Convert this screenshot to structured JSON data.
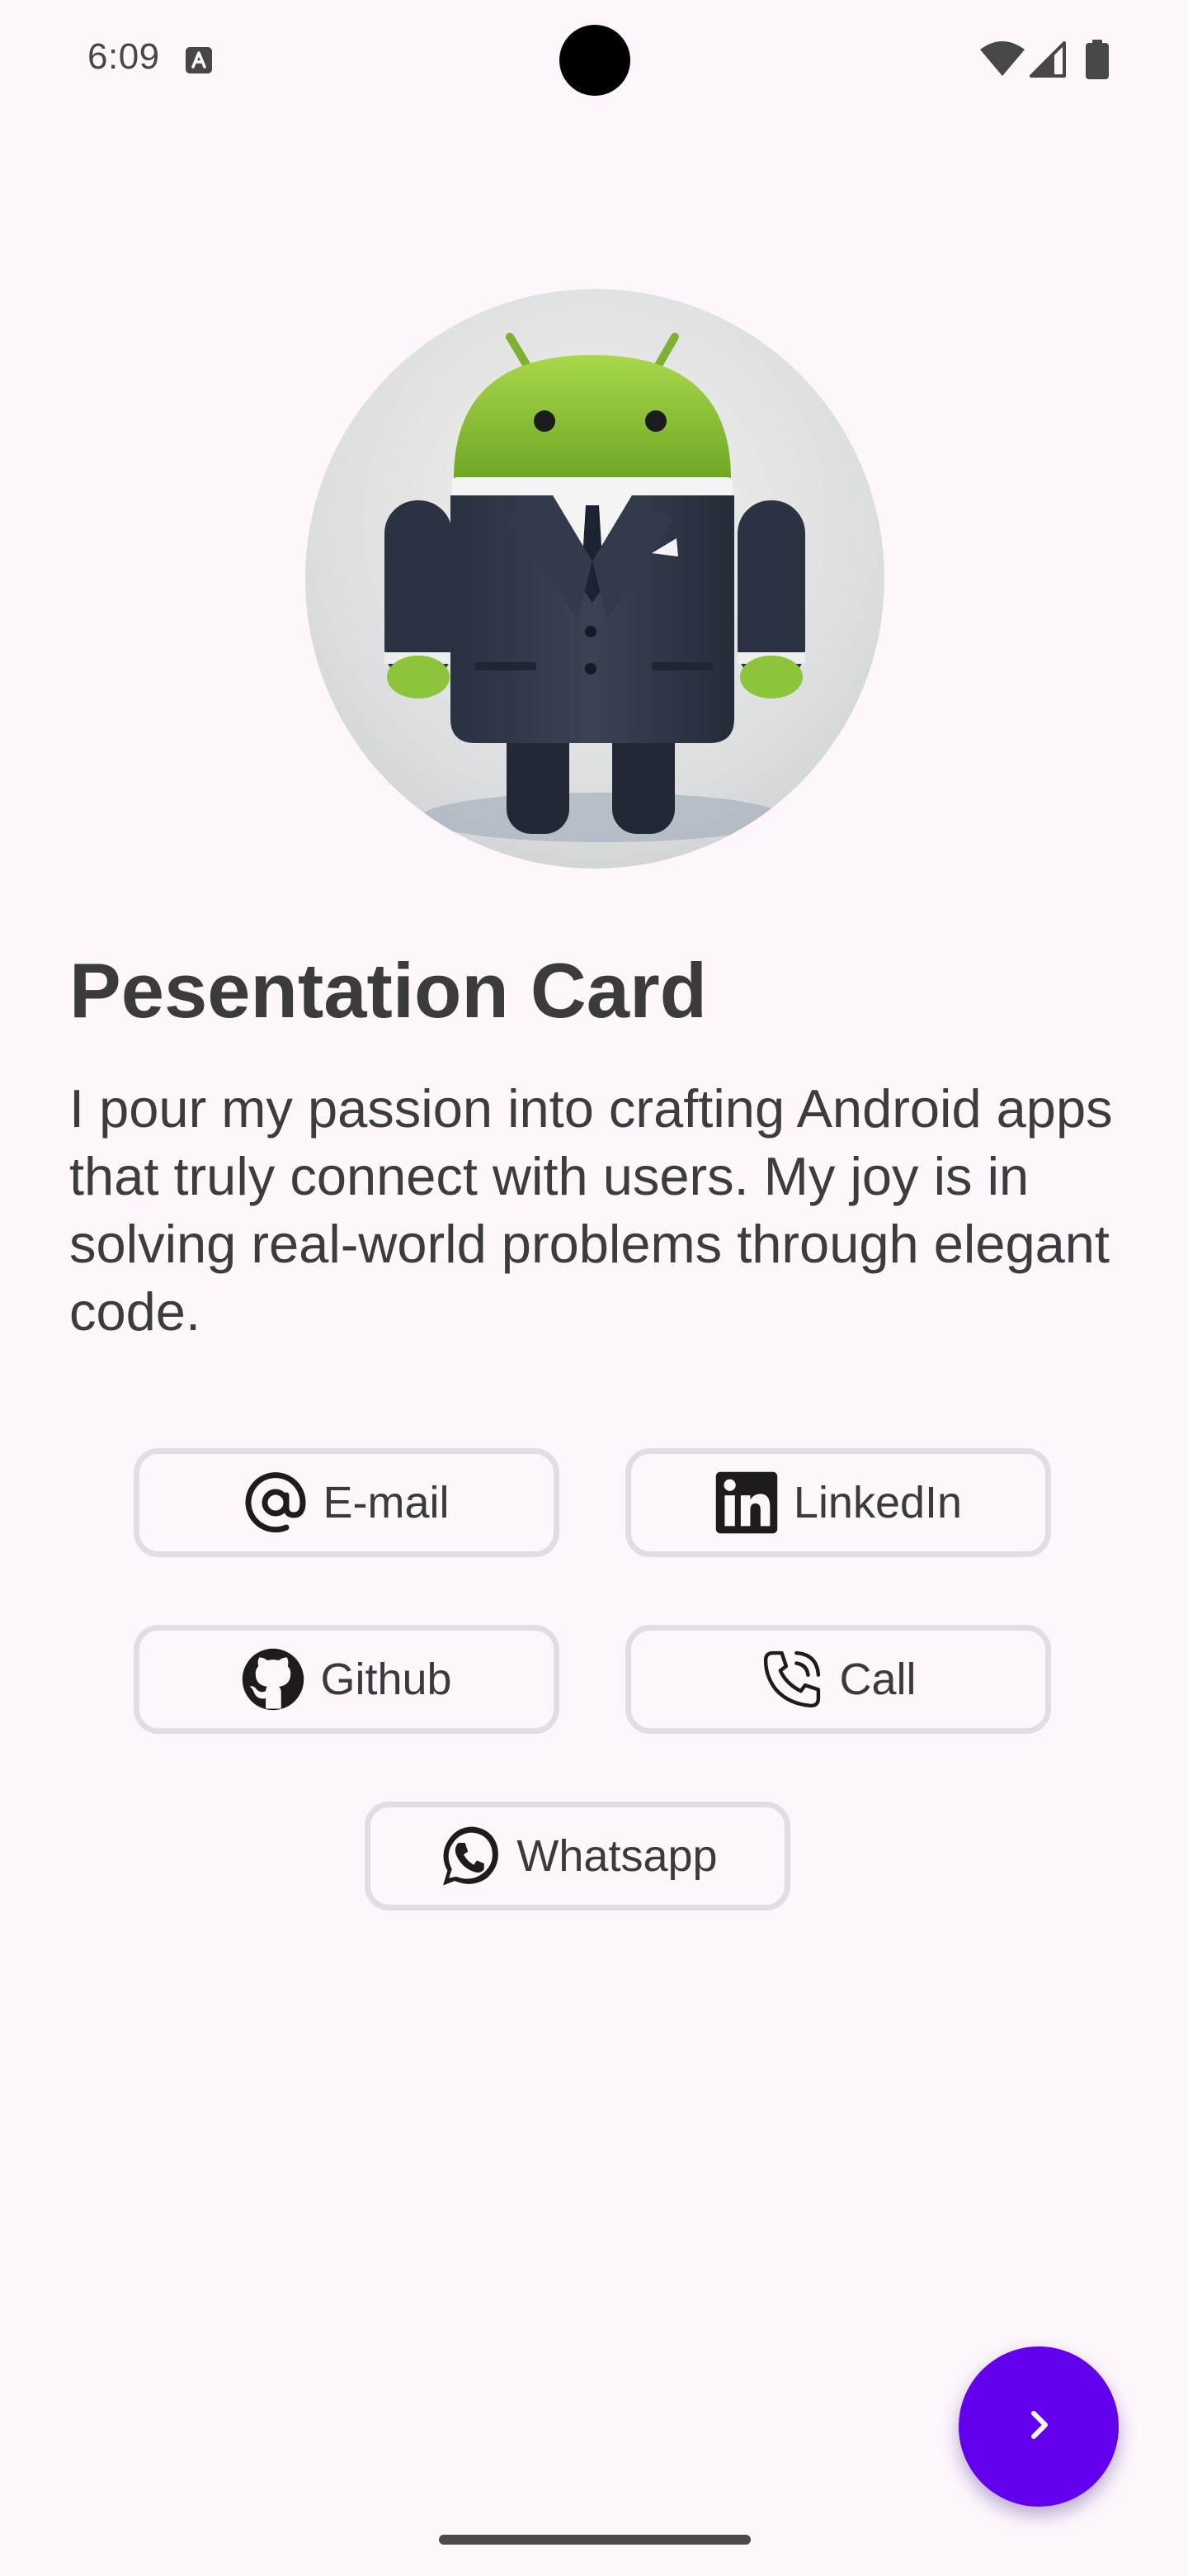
{
  "status_bar": {
    "time": "6:09",
    "icons": [
      "text-a-icon",
      "wifi-icon",
      "signal-icon",
      "battery-icon"
    ]
  },
  "profile": {
    "avatar": "android-robot-in-suit",
    "title": "Pesentation Card",
    "description": "I pour my passion into crafting Android apps that truly connect with users. My joy is in solving real-world problems through elegant code."
  },
  "contact_buttons": [
    {
      "label": "E-mail",
      "icon": "at-sign-icon"
    },
    {
      "label": "LinkedIn",
      "icon": "linkedin-icon"
    },
    {
      "label": "Github",
      "icon": "github-icon"
    },
    {
      "label": "Call",
      "icon": "phone-call-icon"
    },
    {
      "label": "Whatsapp",
      "icon": "whatsapp-icon"
    }
  ],
  "fab": {
    "icon": "chevron-right-icon"
  },
  "colors": {
    "background": "#fdf7fd",
    "accent": "#6200ee",
    "button_border": "#e2dde4",
    "text": "#3a393d"
  }
}
